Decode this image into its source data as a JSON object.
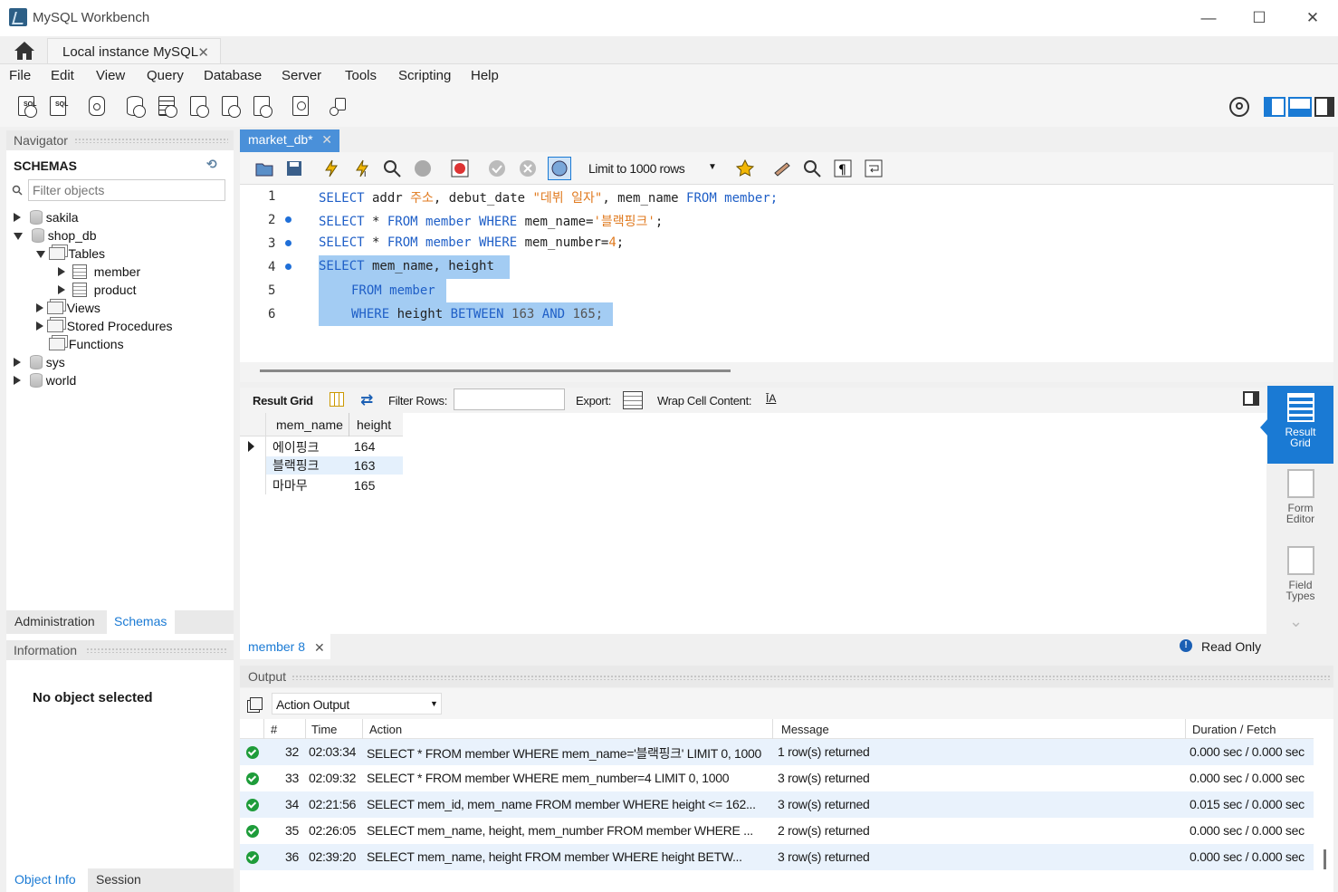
{
  "window": {
    "title": "MySQL Workbench",
    "controls": [
      "—",
      "☐",
      "✕"
    ]
  },
  "tabs": {
    "home_icon": "home-icon",
    "connection": "Local instance MySQL",
    "close": "✕"
  },
  "menu": [
    "File",
    "Edit",
    "View",
    "Query",
    "Database",
    "Server",
    "Tools",
    "Scripting",
    "Help"
  ],
  "navigator": {
    "header": "Navigator",
    "schemas_title": "SCHEMAS",
    "filter_placeholder": "Filter objects",
    "tree": {
      "sakila": "sakila",
      "shop_db": "shop_db",
      "tables": "Tables",
      "member": "member",
      "product": "product",
      "views": "Views",
      "procs": "Stored Procedures",
      "functions": "Functions",
      "sys": "sys",
      "world": "world"
    },
    "bottom_tabs": [
      "Administration",
      "Schemas"
    ],
    "info_header": "Information",
    "info_text": "No object selected",
    "info_tabs": [
      "Object Info",
      "Session"
    ]
  },
  "editor": {
    "tab": "market_db*",
    "limit": "Limit to 1000 rows",
    "line_numbers": [
      "1",
      "2",
      "3",
      "4",
      "5",
      "6"
    ],
    "lines": [
      {
        "a": "SELECT",
        "b": " addr ",
        "c": "주소",
        "d": ", debut_date ",
        "e": "\"데뷔 일자\"",
        "f": ", mem_name ",
        "g": "FROM",
        "h": " member;"
      },
      {
        "a": "SELECT",
        "b": " * ",
        "c": "FROM",
        "d": " member ",
        "e": "WHERE",
        "f": " mem_name=",
        "g": "'블랙핑크'",
        "h": ";"
      },
      {
        "a": "SELECT",
        "b": " * ",
        "c": "FROM",
        "d": " member ",
        "e": "WHERE",
        "f": " mem_number=",
        "g": "4",
        "h": ";"
      },
      {
        "a": "SELECT",
        "b": " mem_name, height"
      },
      {
        "a": "FROM",
        "b": " member"
      },
      {
        "a": "WHERE",
        "b": " height ",
        "c": "BETWEEN",
        "d": " 163 ",
        "e": "AND",
        "f": " 165;"
      }
    ]
  },
  "results": {
    "toolbar": {
      "result_grid": "Result Grid",
      "filter": "Filter Rows:",
      "export": "Export:",
      "wrap": "Wrap Cell Content:"
    },
    "columns": [
      "mem_name",
      "height"
    ],
    "rows": [
      [
        "에이핑크",
        "164"
      ],
      [
        "블랙핑크",
        "163"
      ],
      [
        "마마무",
        "165"
      ]
    ],
    "side": {
      "result_grid": [
        "Result",
        "Grid"
      ],
      "form_editor": [
        "Form",
        "Editor"
      ],
      "field_types": [
        "Field",
        "Types"
      ]
    },
    "result_tab": "member 8",
    "read_only": "Read Only"
  },
  "output": {
    "header": "Output",
    "selector": "Action Output",
    "columns": [
      "#",
      "Time",
      "Action",
      "Message",
      "Duration / Fetch"
    ],
    "rows": [
      {
        "n": "32",
        "time": "02:03:34",
        "action": "SELECT * FROM member WHERE mem_name='블랙핑크' LIMIT 0, 1000",
        "msg": "1 row(s) returned",
        "dur": "0.000 sec / 0.000 sec"
      },
      {
        "n": "33",
        "time": "02:09:32",
        "action": "SELECT * FROM member WHERE mem_number=4 LIMIT 0, 1000",
        "msg": "3 row(s) returned",
        "dur": "0.000 sec / 0.000 sec"
      },
      {
        "n": "34",
        "time": "02:21:56",
        "action": "SELECT mem_id, mem_name  FROM member      WHERE height <= 162...",
        "msg": "3 row(s) returned",
        "dur": "0.015 sec / 0.000 sec"
      },
      {
        "n": "35",
        "time": "02:26:05",
        "action": "SELECT mem_name, height, mem_number  FROM member      WHERE ...",
        "msg": "2 row(s) returned",
        "dur": "0.000 sec / 0.000 sec"
      },
      {
        "n": "36",
        "time": "02:39:20",
        "action": "SELECT mem_name, height      FROM member      WHERE height BETW...",
        "msg": "3 row(s) returned",
        "dur": "0.000 sec / 0.000 sec"
      }
    ]
  },
  "colors": {
    "accent": "#1a7ad4",
    "tab_active": "#4a90d9",
    "selection": "#a3ccf3",
    "keyword": "#1f5fc7",
    "string": "#e07a1f",
    "ok": "#1e9c3a"
  }
}
